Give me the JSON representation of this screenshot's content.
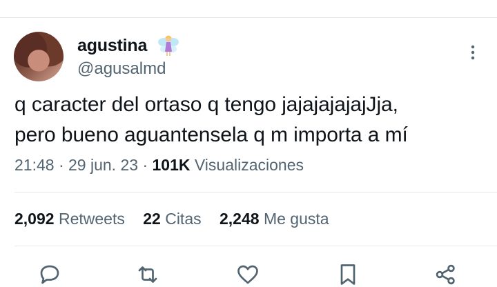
{
  "tweet": {
    "author": {
      "display_name": "agustina",
      "emoji": "fairy",
      "username": "@agusalmd"
    },
    "text_lines": [
      "q caracter del ortaso q tengo jajajajajajJja,",
      "pero bueno aguantensela q m importa a mí"
    ],
    "time": "21:48",
    "date": "29 jun. 23",
    "separator": "·",
    "views_count": "101K",
    "views_label": "Visualizaciones"
  },
  "stats": {
    "retweets_count": "2,092",
    "retweets_label": "Retweets",
    "quotes_count": "22",
    "quotes_label": "Citas",
    "likes_count": "2,248",
    "likes_label": "Me gusta"
  },
  "icons": {
    "more": "more-vertical-icon",
    "reply": "reply-icon",
    "retweet": "retweet-icon",
    "like": "heart-icon",
    "bookmark": "bookmark-icon",
    "share": "share-icon"
  },
  "colors": {
    "text": "#0f1419",
    "secondary": "#536471",
    "divider": "#e6e9eb"
  }
}
